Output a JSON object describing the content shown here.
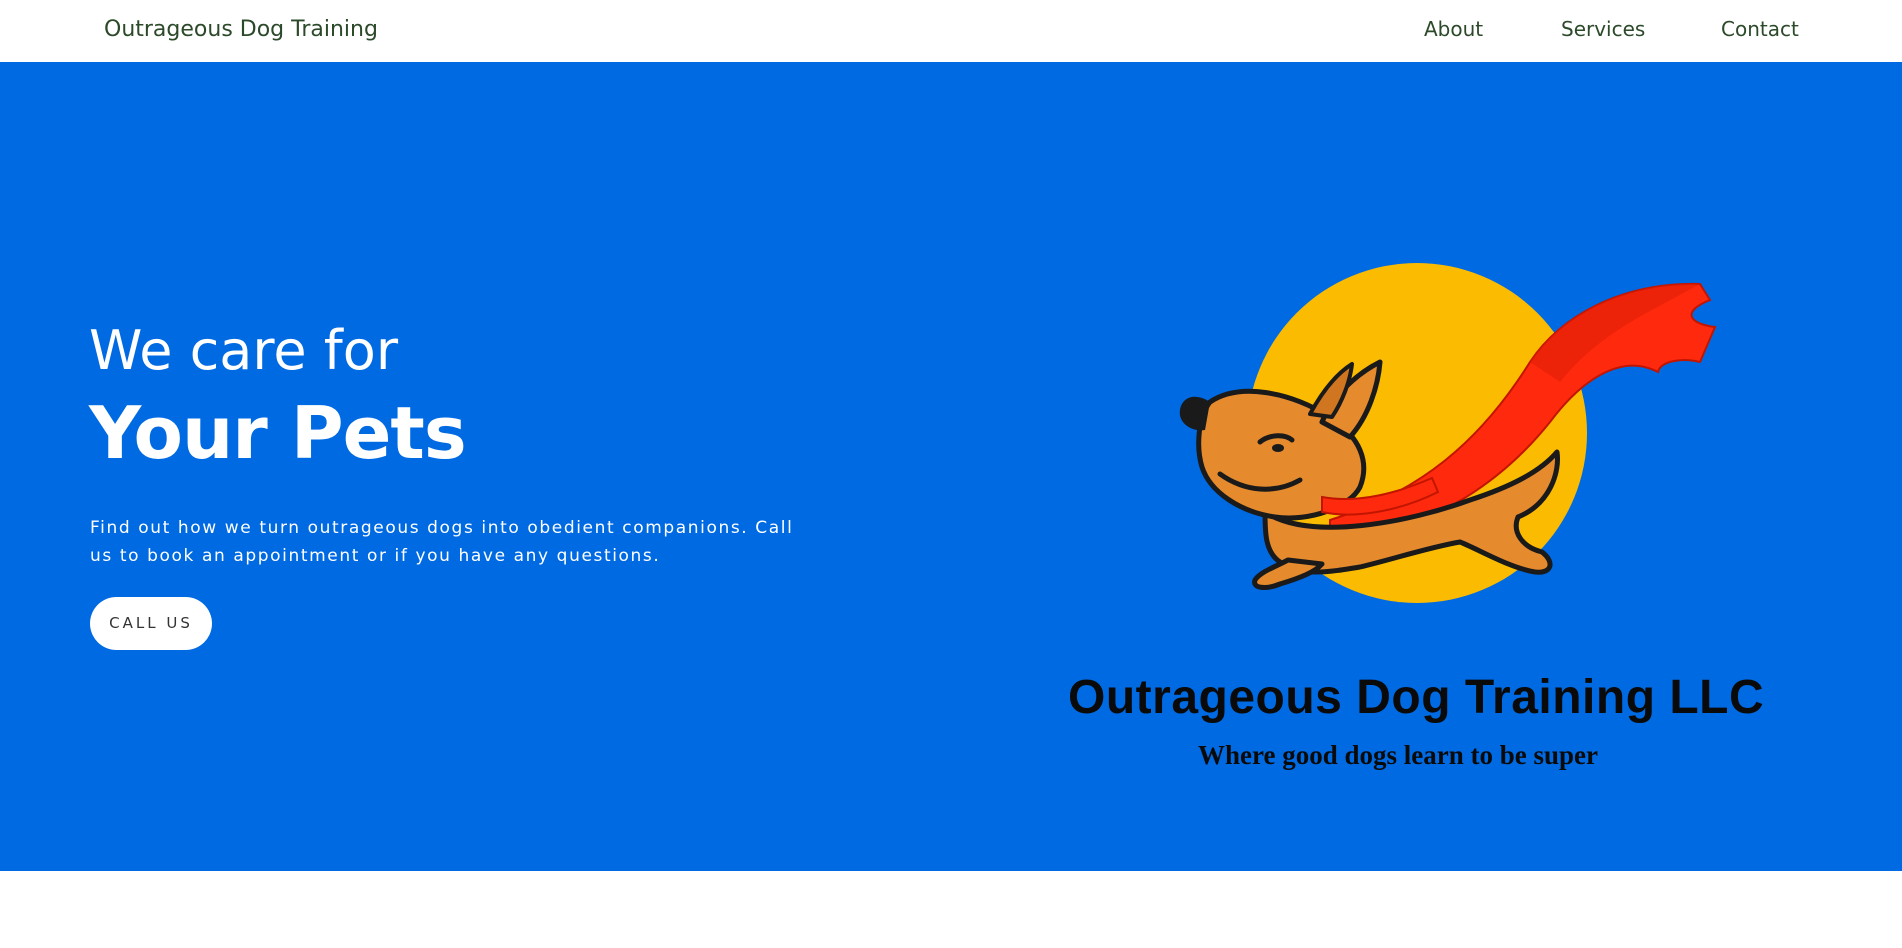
{
  "nav": {
    "brand": "Outrageous Dog Training",
    "links": [
      "About",
      "Services",
      "Contact"
    ]
  },
  "hero": {
    "kicker": "We care for",
    "title": "Your Pets",
    "description": "Find out how we turn outrageous dogs into obedient companions. Call us to book an appointment or if you have any questions.",
    "cta_label": "CALL US"
  },
  "logo": {
    "title": "Outrageous Dog Training LLC",
    "tagline": "Where good dogs learn to be super"
  },
  "colors": {
    "hero_bg": "#006ae3",
    "nav_text": "#2c4a2a",
    "sun": "#fbbb00",
    "cape": "#ff2a0d",
    "dog": "#e58a2d"
  }
}
